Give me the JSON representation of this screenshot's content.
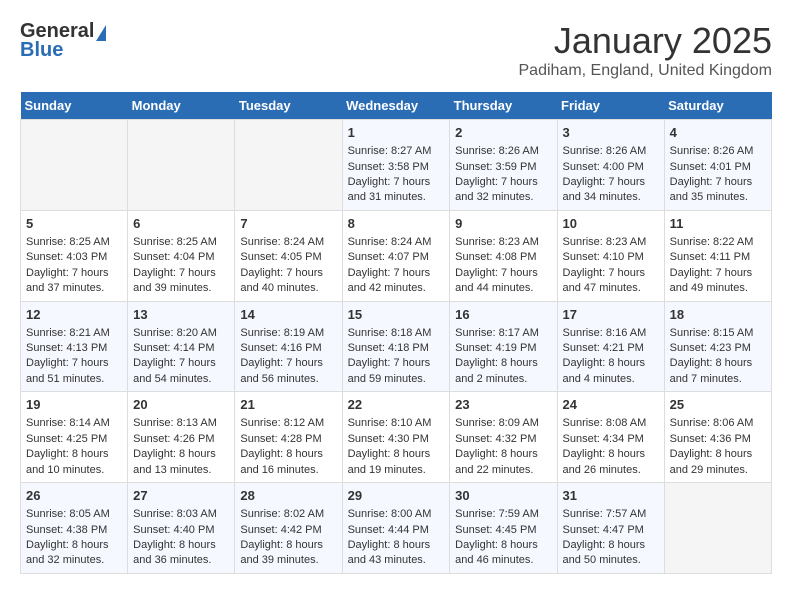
{
  "header": {
    "logo_general": "General",
    "logo_blue": "Blue",
    "month_title": "January 2025",
    "subtitle": "Padiham, England, United Kingdom"
  },
  "days_of_week": [
    "Sunday",
    "Monday",
    "Tuesday",
    "Wednesday",
    "Thursday",
    "Friday",
    "Saturday"
  ],
  "weeks": [
    [
      {
        "day": "",
        "content": ""
      },
      {
        "day": "",
        "content": ""
      },
      {
        "day": "",
        "content": ""
      },
      {
        "day": "1",
        "content": "Sunrise: 8:27 AM\nSunset: 3:58 PM\nDaylight: 7 hours\nand 31 minutes."
      },
      {
        "day": "2",
        "content": "Sunrise: 8:26 AM\nSunset: 3:59 PM\nDaylight: 7 hours\nand 32 minutes."
      },
      {
        "day": "3",
        "content": "Sunrise: 8:26 AM\nSunset: 4:00 PM\nDaylight: 7 hours\nand 34 minutes."
      },
      {
        "day": "4",
        "content": "Sunrise: 8:26 AM\nSunset: 4:01 PM\nDaylight: 7 hours\nand 35 minutes."
      }
    ],
    [
      {
        "day": "5",
        "content": "Sunrise: 8:25 AM\nSunset: 4:03 PM\nDaylight: 7 hours\nand 37 minutes."
      },
      {
        "day": "6",
        "content": "Sunrise: 8:25 AM\nSunset: 4:04 PM\nDaylight: 7 hours\nand 39 minutes."
      },
      {
        "day": "7",
        "content": "Sunrise: 8:24 AM\nSunset: 4:05 PM\nDaylight: 7 hours\nand 40 minutes."
      },
      {
        "day": "8",
        "content": "Sunrise: 8:24 AM\nSunset: 4:07 PM\nDaylight: 7 hours\nand 42 minutes."
      },
      {
        "day": "9",
        "content": "Sunrise: 8:23 AM\nSunset: 4:08 PM\nDaylight: 7 hours\nand 44 minutes."
      },
      {
        "day": "10",
        "content": "Sunrise: 8:23 AM\nSunset: 4:10 PM\nDaylight: 7 hours\nand 47 minutes."
      },
      {
        "day": "11",
        "content": "Sunrise: 8:22 AM\nSunset: 4:11 PM\nDaylight: 7 hours\nand 49 minutes."
      }
    ],
    [
      {
        "day": "12",
        "content": "Sunrise: 8:21 AM\nSunset: 4:13 PM\nDaylight: 7 hours\nand 51 minutes."
      },
      {
        "day": "13",
        "content": "Sunrise: 8:20 AM\nSunset: 4:14 PM\nDaylight: 7 hours\nand 54 minutes."
      },
      {
        "day": "14",
        "content": "Sunrise: 8:19 AM\nSunset: 4:16 PM\nDaylight: 7 hours\nand 56 minutes."
      },
      {
        "day": "15",
        "content": "Sunrise: 8:18 AM\nSunset: 4:18 PM\nDaylight: 7 hours\nand 59 minutes."
      },
      {
        "day": "16",
        "content": "Sunrise: 8:17 AM\nSunset: 4:19 PM\nDaylight: 8 hours\nand 2 minutes."
      },
      {
        "day": "17",
        "content": "Sunrise: 8:16 AM\nSunset: 4:21 PM\nDaylight: 8 hours\nand 4 minutes."
      },
      {
        "day": "18",
        "content": "Sunrise: 8:15 AM\nSunset: 4:23 PM\nDaylight: 8 hours\nand 7 minutes."
      }
    ],
    [
      {
        "day": "19",
        "content": "Sunrise: 8:14 AM\nSunset: 4:25 PM\nDaylight: 8 hours\nand 10 minutes."
      },
      {
        "day": "20",
        "content": "Sunrise: 8:13 AM\nSunset: 4:26 PM\nDaylight: 8 hours\nand 13 minutes."
      },
      {
        "day": "21",
        "content": "Sunrise: 8:12 AM\nSunset: 4:28 PM\nDaylight: 8 hours\nand 16 minutes."
      },
      {
        "day": "22",
        "content": "Sunrise: 8:10 AM\nSunset: 4:30 PM\nDaylight: 8 hours\nand 19 minutes."
      },
      {
        "day": "23",
        "content": "Sunrise: 8:09 AM\nSunset: 4:32 PM\nDaylight: 8 hours\nand 22 minutes."
      },
      {
        "day": "24",
        "content": "Sunrise: 8:08 AM\nSunset: 4:34 PM\nDaylight: 8 hours\nand 26 minutes."
      },
      {
        "day": "25",
        "content": "Sunrise: 8:06 AM\nSunset: 4:36 PM\nDaylight: 8 hours\nand 29 minutes."
      }
    ],
    [
      {
        "day": "26",
        "content": "Sunrise: 8:05 AM\nSunset: 4:38 PM\nDaylight: 8 hours\nand 32 minutes."
      },
      {
        "day": "27",
        "content": "Sunrise: 8:03 AM\nSunset: 4:40 PM\nDaylight: 8 hours\nand 36 minutes."
      },
      {
        "day": "28",
        "content": "Sunrise: 8:02 AM\nSunset: 4:42 PM\nDaylight: 8 hours\nand 39 minutes."
      },
      {
        "day": "29",
        "content": "Sunrise: 8:00 AM\nSunset: 4:44 PM\nDaylight: 8 hours\nand 43 minutes."
      },
      {
        "day": "30",
        "content": "Sunrise: 7:59 AM\nSunset: 4:45 PM\nDaylight: 8 hours\nand 46 minutes."
      },
      {
        "day": "31",
        "content": "Sunrise: 7:57 AM\nSunset: 4:47 PM\nDaylight: 8 hours\nand 50 minutes."
      },
      {
        "day": "",
        "content": ""
      }
    ]
  ]
}
